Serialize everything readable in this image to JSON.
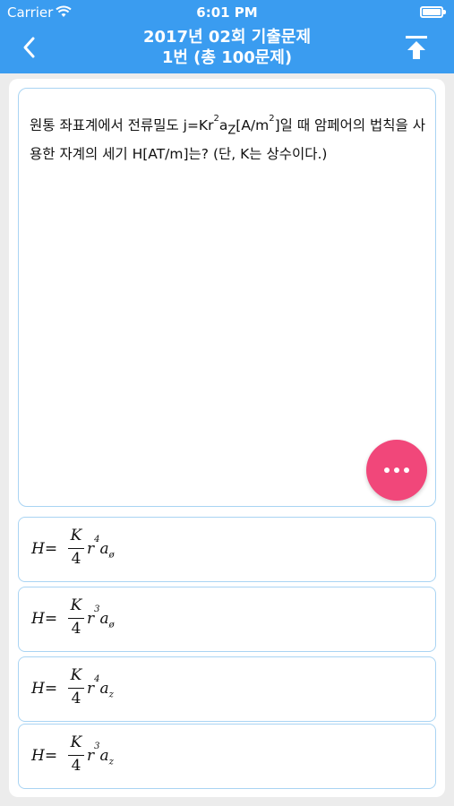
{
  "status_bar": {
    "carrier": "Carrier",
    "time": "6:01 PM"
  },
  "nav": {
    "title_line1": "2017년 02회 기출문제",
    "title_line2": "1번 (총 100문제)"
  },
  "question": {
    "part1": "원통 좌표계에서 전류밀도 j=Kr",
    "sup1": "2",
    "part2": "a",
    "sub1": "Z",
    "part3": "[A/m",
    "sup2": "2",
    "part4": "]일 때 암페어의 법칙을 사용한 자계의 세기 H[AT/m]는? (단, K는 상수이다.)"
  },
  "options": [
    {
      "lhs": "H=",
      "num": "K",
      "den": "4",
      "r": "r",
      "exp": "4",
      "a": "a",
      "sub": "ø"
    },
    {
      "lhs": "H=",
      "num": "K",
      "den": "4",
      "r": "r",
      "exp": "3",
      "a": "a",
      "sub": "ø"
    },
    {
      "lhs": "H=",
      "num": "K",
      "den": "4",
      "r": "r",
      "exp": "4",
      "a": "a",
      "sub": "z"
    },
    {
      "lhs": "H=",
      "num": "K",
      "den": "4",
      "r": "r",
      "exp": "3",
      "a": "a",
      "sub": "z"
    }
  ],
  "colors": {
    "header": "#3a9cf0",
    "fab": "#f1477a",
    "card_border": "#a9d4f3"
  },
  "icons": {
    "back": "chevron-left-icon",
    "top": "scroll-to-top-icon",
    "fab": "more-dots-icon"
  }
}
